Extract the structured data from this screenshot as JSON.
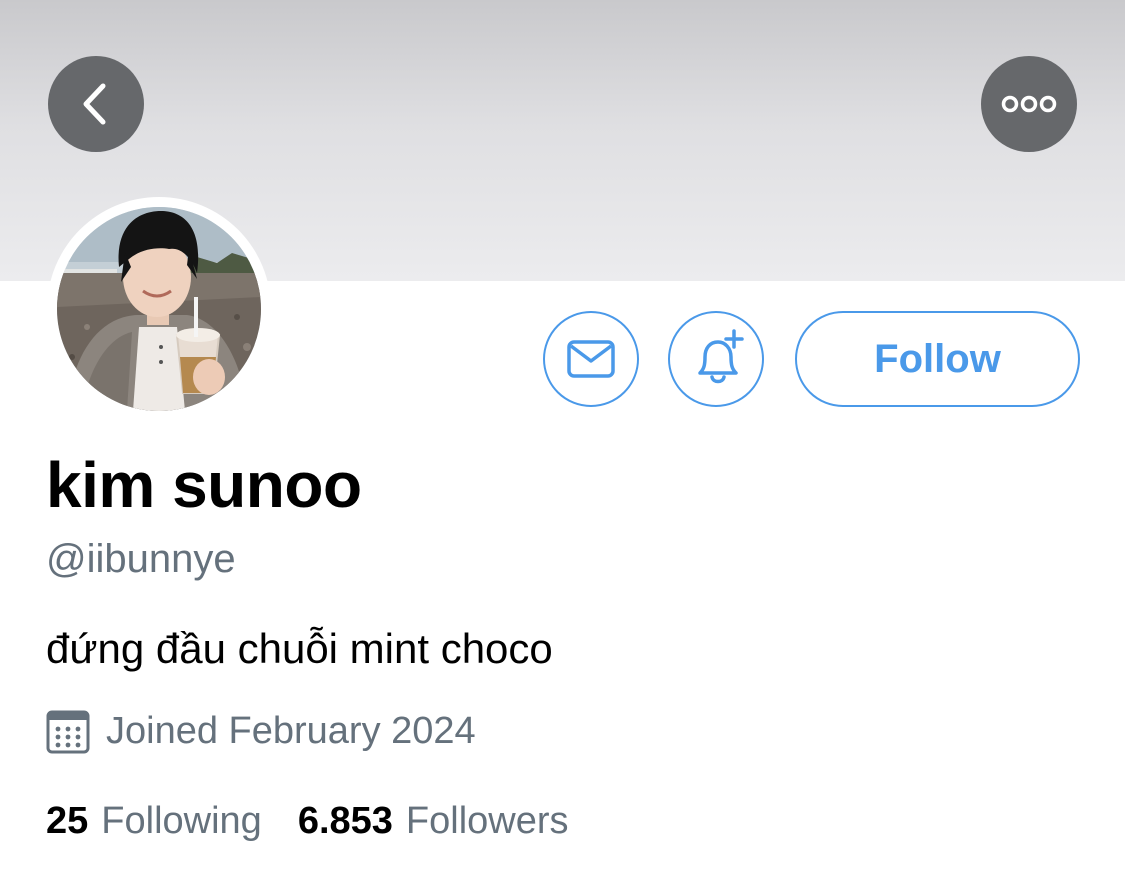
{
  "nav": {
    "back_icon": "chevron-left-icon",
    "more_icon": "ellipsis-icon"
  },
  "profile": {
    "display_name": "kim sunoo",
    "handle": "@iibunnye",
    "bio": "đứng đầu chuỗi mint choco",
    "joined": "Joined February 2024",
    "following_count": "25",
    "following_label": "Following",
    "followers_count": "6.853",
    "followers_label": "Followers"
  },
  "actions": {
    "message_icon": "mail-icon",
    "notify_icon": "bell-plus-icon",
    "follow_label": "Follow"
  },
  "colors": {
    "accent": "#4a99e9",
    "secondary_text": "#65717c",
    "nav_button_bg": "#66686b"
  }
}
